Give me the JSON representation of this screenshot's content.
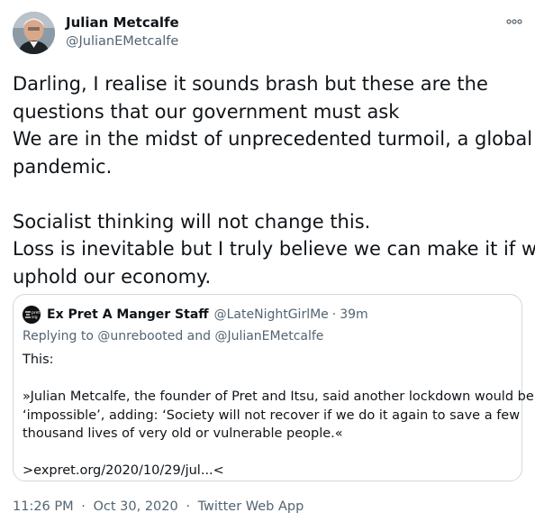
{
  "tweet": {
    "author": {
      "name": "Julian Metcalfe",
      "handle": "@JulianEMetcalfe"
    },
    "more_icon": "more-dots-icon",
    "text_lines": [
      "Darling, I realise it sounds brash but these are the",
      "questions that our government must ask",
      "We are in the midst of unprecedented turmoil, a global",
      "pandemic.",
      "",
      "Socialist thinking will not change this.",
      "Loss is inevitable but I truly believe we can make it if we",
      "uphold our economy."
    ],
    "quoted": {
      "author_name": "Ex Pret A Manger Staff",
      "handle": "@LateNightGirlMe",
      "dot": "·",
      "time": "39m",
      "reply_prefix": "Replying to",
      "reply_mentions": "@unrebooted and @JulianEMetcalfe",
      "text_lines": [
        "This:",
        "",
        "»Julian Metcalfe, the founder of Pret and Itsu, said another lockdown would be",
        "‘impossible’, adding: ‘Society will not recover if we do it again to save a few",
        "thousand lives of very old or vulnerable people.«",
        "",
        ">expret.org/2020/10/29/jul...<"
      ]
    },
    "meta": {
      "time": "11:26 PM",
      "date": "Oct 30, 2020",
      "dot": "·",
      "source": "Twitter Web App"
    }
  }
}
